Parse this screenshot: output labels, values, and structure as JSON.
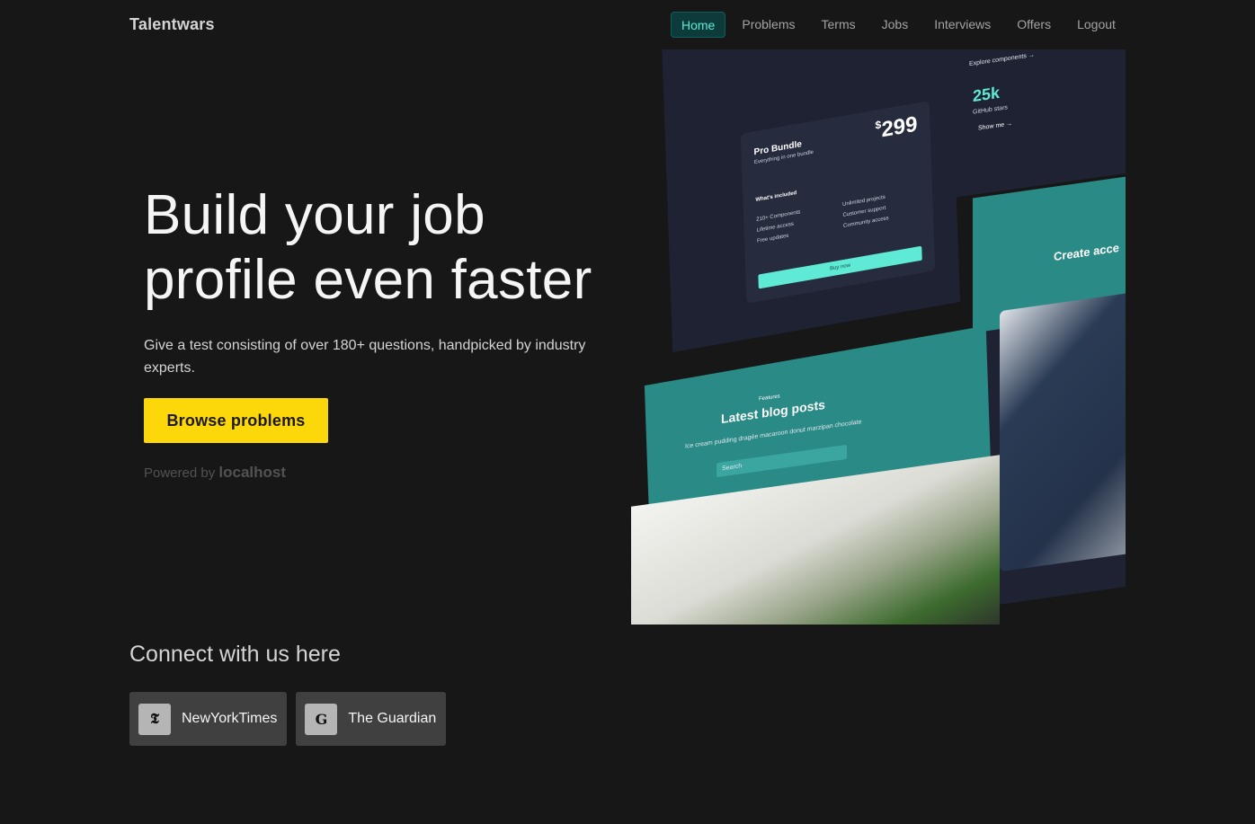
{
  "brand": "Talentwars",
  "nav": {
    "items": [
      {
        "label": "Home",
        "active": true
      },
      {
        "label": "Problems",
        "active": false
      },
      {
        "label": "Terms",
        "active": false
      },
      {
        "label": "Jobs",
        "active": false
      },
      {
        "label": "Interviews",
        "active": false
      },
      {
        "label": "Offers",
        "active": false
      },
      {
        "label": "Logout",
        "active": false
      }
    ]
  },
  "hero": {
    "title_line1": "Build your job",
    "title_line2": "profile even faster",
    "subtitle": "Give a test consisting of over 180+ questions, handpicked by industry experts.",
    "cta_label": "Browse problems",
    "powered_prefix": "Powered by",
    "powered_brand": "localhost"
  },
  "mosaic": {
    "card_title": "Pro Bundle",
    "card_subtitle": "Everything in one bundle",
    "card_currency": "$",
    "card_price": "299",
    "card_included": "What's included",
    "card_features": [
      "210+ Components",
      "Lifetime access",
      "Free updates",
      "Unlimited projects",
      "Customer support",
      "Community access"
    ],
    "card_button": "Buy now",
    "stat_value": "25k",
    "stat_label": "GitHub stars",
    "stat_link": "Show me →",
    "explore_link": "Explore components →",
    "blog_kicker": "Features",
    "blog_title": "Latest blog posts",
    "blog_subtitle": "Ice cream pudding dragée macaroon donut marzipan chocolate",
    "blog_search": "Search",
    "create_title": "Create acce"
  },
  "connect": {
    "title": "Connect with us here",
    "partners": [
      {
        "name": "NewYorkTimes",
        "glyph": "𝕿",
        "icon": "nyt-logo-icon"
      },
      {
        "name": "The Guardian",
        "glyph": "G",
        "icon": "guardian-logo-icon"
      }
    ]
  },
  "colors": {
    "background": "#171717",
    "accent_teal": "#5eead4",
    "cta_yellow": "#fcd70a"
  }
}
